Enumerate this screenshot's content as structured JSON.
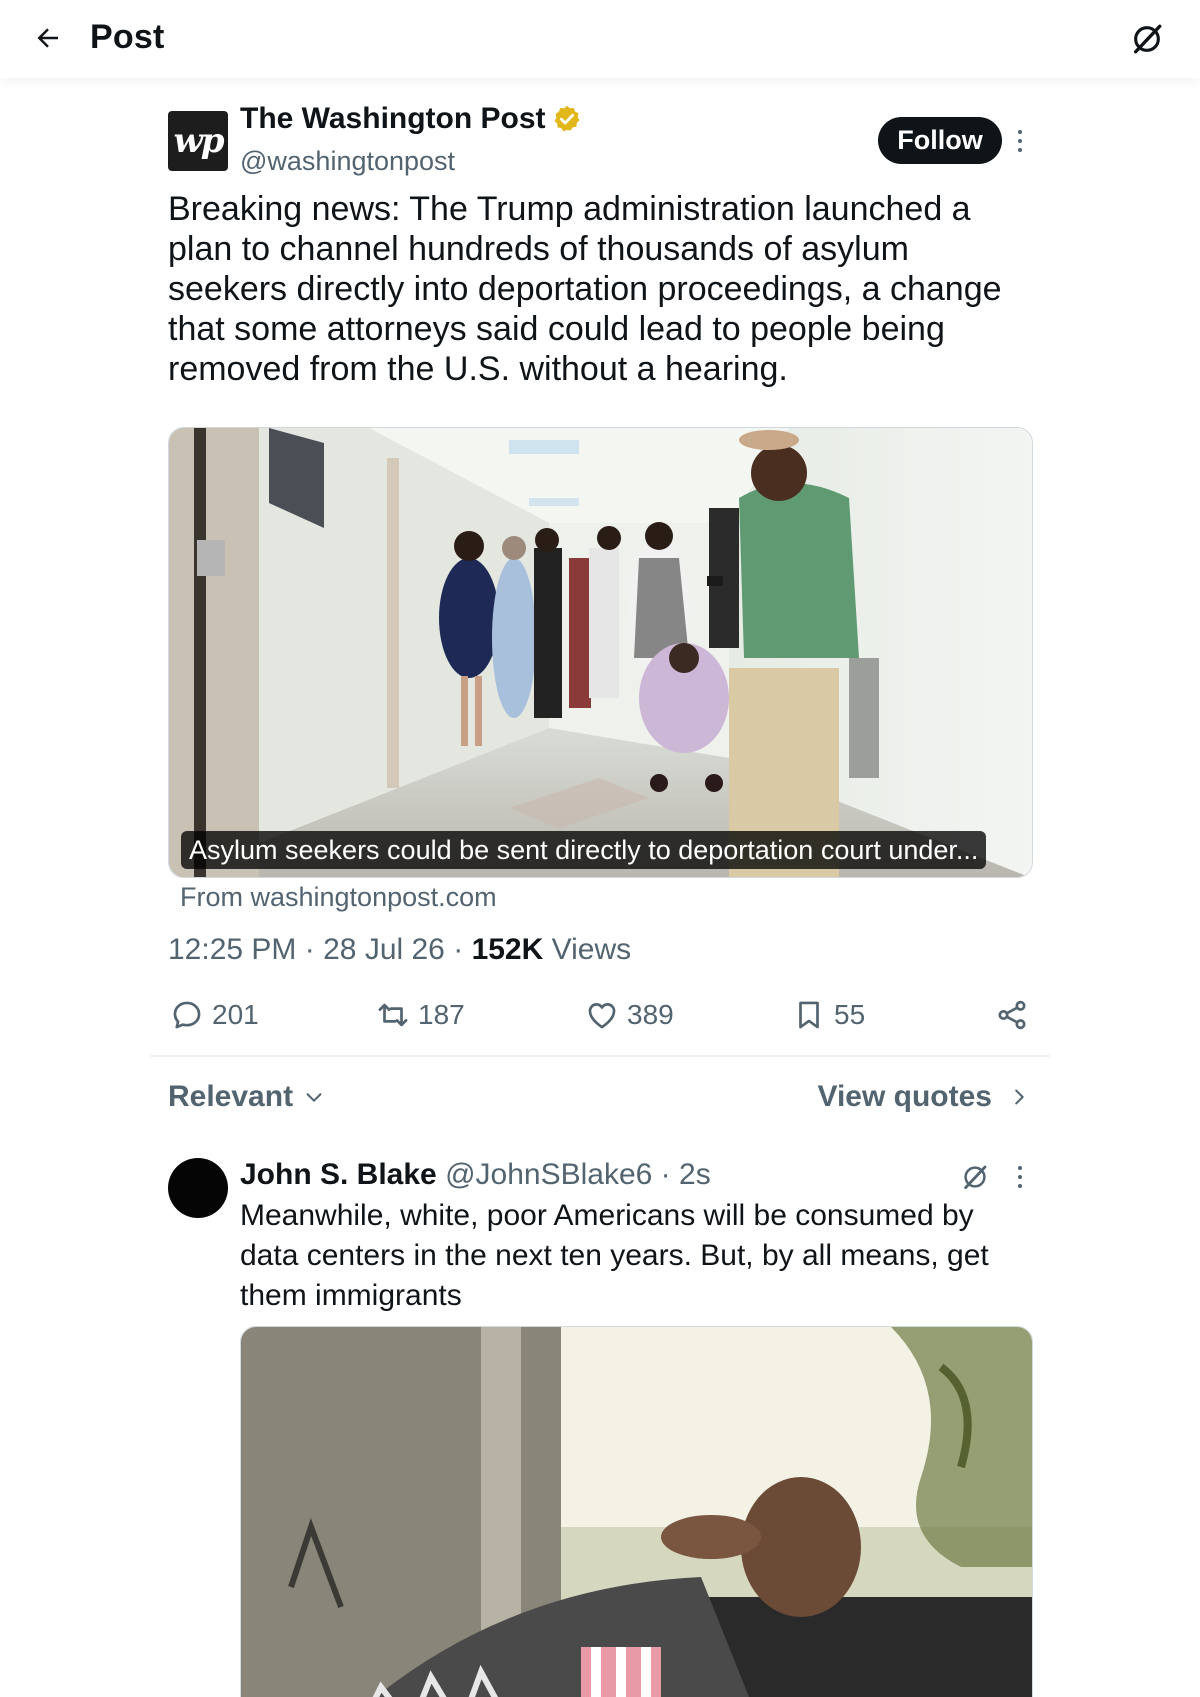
{
  "header": {
    "title": "Post",
    "back_icon": "arrow-left-icon",
    "grok_icon": "grok-icon"
  },
  "post": {
    "author": {
      "name": "The Washington Post",
      "handle": "@washingtonpost",
      "avatar_text": "wp",
      "verified": true,
      "verified_color": "#e2b719"
    },
    "follow_label": "Follow",
    "text": "Breaking news: The Trump administration launched a plan to channel hundreds of thousands of asylum seekers directly into deportation proceedings, a change that some attorneys said could lead to people being removed from the U.S. without a hearing.",
    "card": {
      "caption": "Asylum seekers could be sent directly to deportation court under...",
      "source": "From washingtonpost.com"
    },
    "meta": {
      "time": "12:25 PM",
      "date": "28 Jul 26",
      "views_count": "152K",
      "views_label": "Views",
      "separator": "·"
    },
    "actions": {
      "replies": "201",
      "reposts": "187",
      "likes": "389",
      "bookmarks": "55"
    }
  },
  "replies_bar": {
    "sort_label": "Relevant",
    "view_quotes_label": "View quotes"
  },
  "reply": {
    "name": "John S. Blake",
    "handle": "@JohnSBlake6",
    "separator": "·",
    "time": "2s",
    "text": "Meanwhile, white, poor Americans will be consumed by data centers in the next ten years. But,  by all means,  get them immigrants"
  },
  "colors": {
    "text_primary": "#0f1419",
    "text_secondary": "#536471",
    "follow_bg": "#0f1419",
    "divider": "#eff3f4"
  }
}
